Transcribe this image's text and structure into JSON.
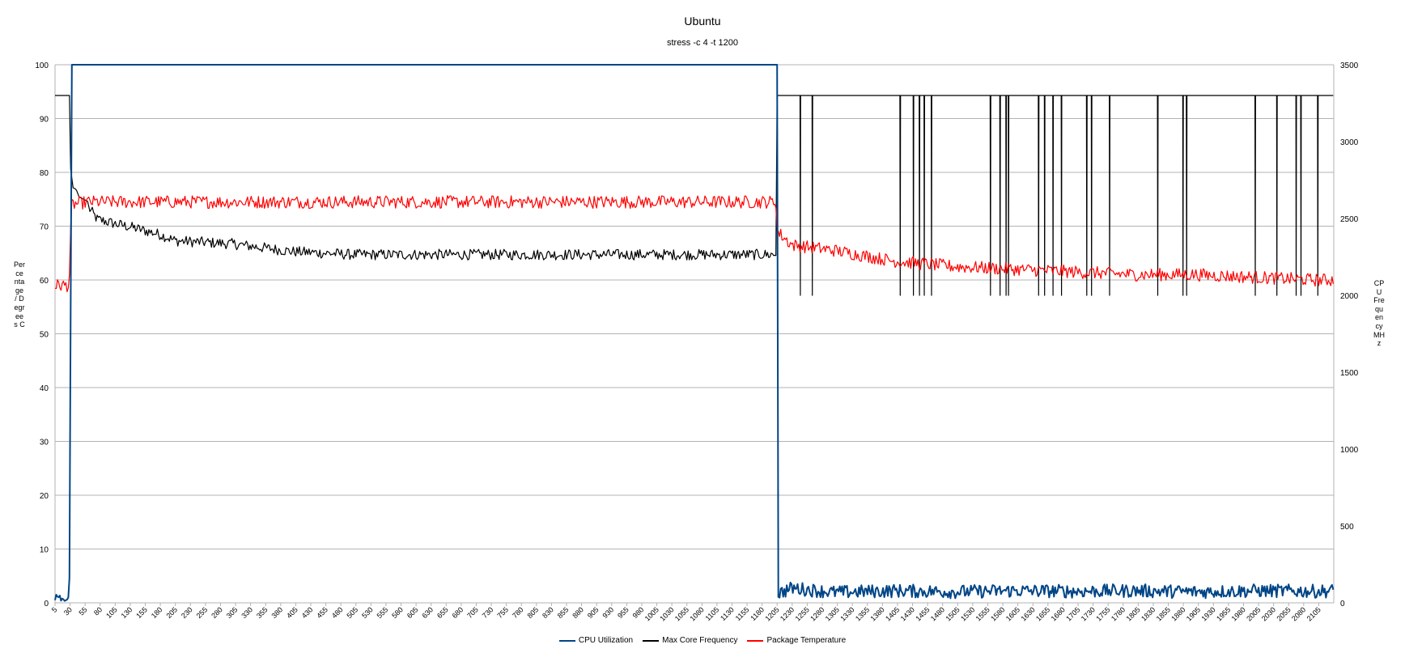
{
  "chart_data": {
    "type": "line",
    "title": "Ubuntu",
    "subtitle": "stress -c 4 -t 1200",
    "ylabel_left": "Percentage / Degrees C",
    "ylabel_right": "CPU Frequency MHz",
    "xlabel": "",
    "xlim": [
      5,
      2130
    ],
    "ylim_left": [
      0,
      100
    ],
    "ylim_right": [
      0,
      3500
    ],
    "yticks_left": [
      0,
      10,
      20,
      30,
      40,
      50,
      60,
      70,
      80,
      90,
      100
    ],
    "yticks_right": [
      0,
      500,
      1000,
      1500,
      2000,
      2500,
      3000,
      3500
    ],
    "xticks": [
      5,
      30,
      55,
      80,
      105,
      130,
      155,
      180,
      205,
      230,
      255,
      280,
      305,
      330,
      355,
      380,
      405,
      430,
      455,
      480,
      505,
      530,
      555,
      580,
      605,
      630,
      655,
      680,
      705,
      730,
      755,
      780,
      805,
      830,
      855,
      880,
      905,
      930,
      955,
      980,
      1005,
      1030,
      1055,
      1080,
      1105,
      1130,
      1155,
      1180,
      1205,
      1230,
      1255,
      1280,
      1305,
      1330,
      1355,
      1380,
      1405,
      1430,
      1455,
      1480,
      1505,
      1530,
      1555,
      1580,
      1605,
      1630,
      1655,
      1680,
      1705,
      1730,
      1755,
      1780,
      1805,
      1830,
      1855,
      1880,
      1905,
      1930,
      1955,
      1980,
      2005,
      2030,
      2055,
      2080,
      2105
    ],
    "grid": true,
    "legend_position": "bottom",
    "series": [
      {
        "name": "CPU Utilization",
        "axis": "left",
        "color": "#004586",
        "points": [
          [
            5,
            0.5
          ],
          [
            8,
            2
          ],
          [
            10,
            0.3
          ],
          [
            12,
            1.8
          ],
          [
            15,
            0.4
          ],
          [
            18,
            1
          ],
          [
            20,
            0.3
          ],
          [
            25,
            0.6
          ],
          [
            28,
            1.2
          ],
          [
            30,
            8
          ],
          [
            32,
            100
          ],
          [
            1205,
            100
          ],
          [
            1207,
            0.5
          ],
          [
            1230,
            1.5
          ],
          [
            1300,
            0.7
          ],
          [
            1400,
            1
          ],
          [
            1500,
            0.8
          ],
          [
            1600,
            1
          ],
          [
            1700,
            0.9
          ],
          [
            1800,
            1
          ],
          [
            1900,
            0.8
          ],
          [
            2000,
            1
          ],
          [
            2100,
            0.9
          ],
          [
            2130,
            1
          ]
        ],
        "noise": {
          "from": 1207,
          "to": 2130,
          "min": 0,
          "max": 2.5
        }
      },
      {
        "name": "Max Core Frequency",
        "axis": "right",
        "color": "#000000",
        "points": [
          [
            5,
            3300
          ],
          [
            28,
            3300
          ],
          [
            30,
            3300
          ],
          [
            31,
            2820
          ],
          [
            35,
            2700
          ],
          [
            40,
            2690
          ],
          [
            45,
            2640
          ],
          [
            60,
            2610
          ],
          [
            75,
            2530
          ],
          [
            105,
            2500
          ],
          [
            130,
            2480
          ],
          [
            160,
            2450
          ],
          [
            180,
            2430
          ],
          [
            205,
            2390
          ],
          [
            300,
            2370
          ],
          [
            400,
            2320
          ],
          [
            500,
            2300
          ],
          [
            700,
            2300
          ],
          [
            900,
            2300
          ],
          [
            1100,
            2300
          ],
          [
            1204,
            2300
          ],
          [
            1205,
            3300
          ],
          [
            2130,
            3300
          ]
        ],
        "noise": {
          "from": 60,
          "to": 1204,
          "min": -70,
          "max": 0
        },
        "dips_to": 2000,
        "dips_at": [
          1243,
          1263,
          1410,
          1431,
          1441,
          1449,
          1462,
          1560,
          1575,
          1585,
          1590,
          1640,
          1650,
          1663,
          1677,
          1719,
          1728,
          1757,
          1837,
          1879,
          1885,
          2000,
          2036,
          2068,
          2076,
          2104
        ]
      },
      {
        "name": "Package Temperature",
        "axis": "left",
        "color": "#ff0000",
        "points": [
          [
            5,
            59
          ],
          [
            28,
            59
          ],
          [
            30,
            63
          ],
          [
            32,
            74
          ],
          [
            60,
            74.5
          ],
          [
            1204,
            74.5
          ],
          [
            1205,
            69
          ],
          [
            1215,
            68
          ],
          [
            1230,
            66.5
          ],
          [
            1300,
            65.5
          ],
          [
            1350,
            64.5
          ],
          [
            1400,
            63.5
          ],
          [
            1500,
            62.5
          ],
          [
            1600,
            62
          ],
          [
            1700,
            61.5
          ],
          [
            1800,
            61
          ],
          [
            1900,
            61
          ],
          [
            2000,
            60.5
          ],
          [
            2100,
            60
          ],
          [
            2130,
            60
          ]
        ],
        "noise": {
          "from": 5,
          "to": 2130,
          "min": -1.2,
          "max": 1.2
        }
      }
    ]
  }
}
